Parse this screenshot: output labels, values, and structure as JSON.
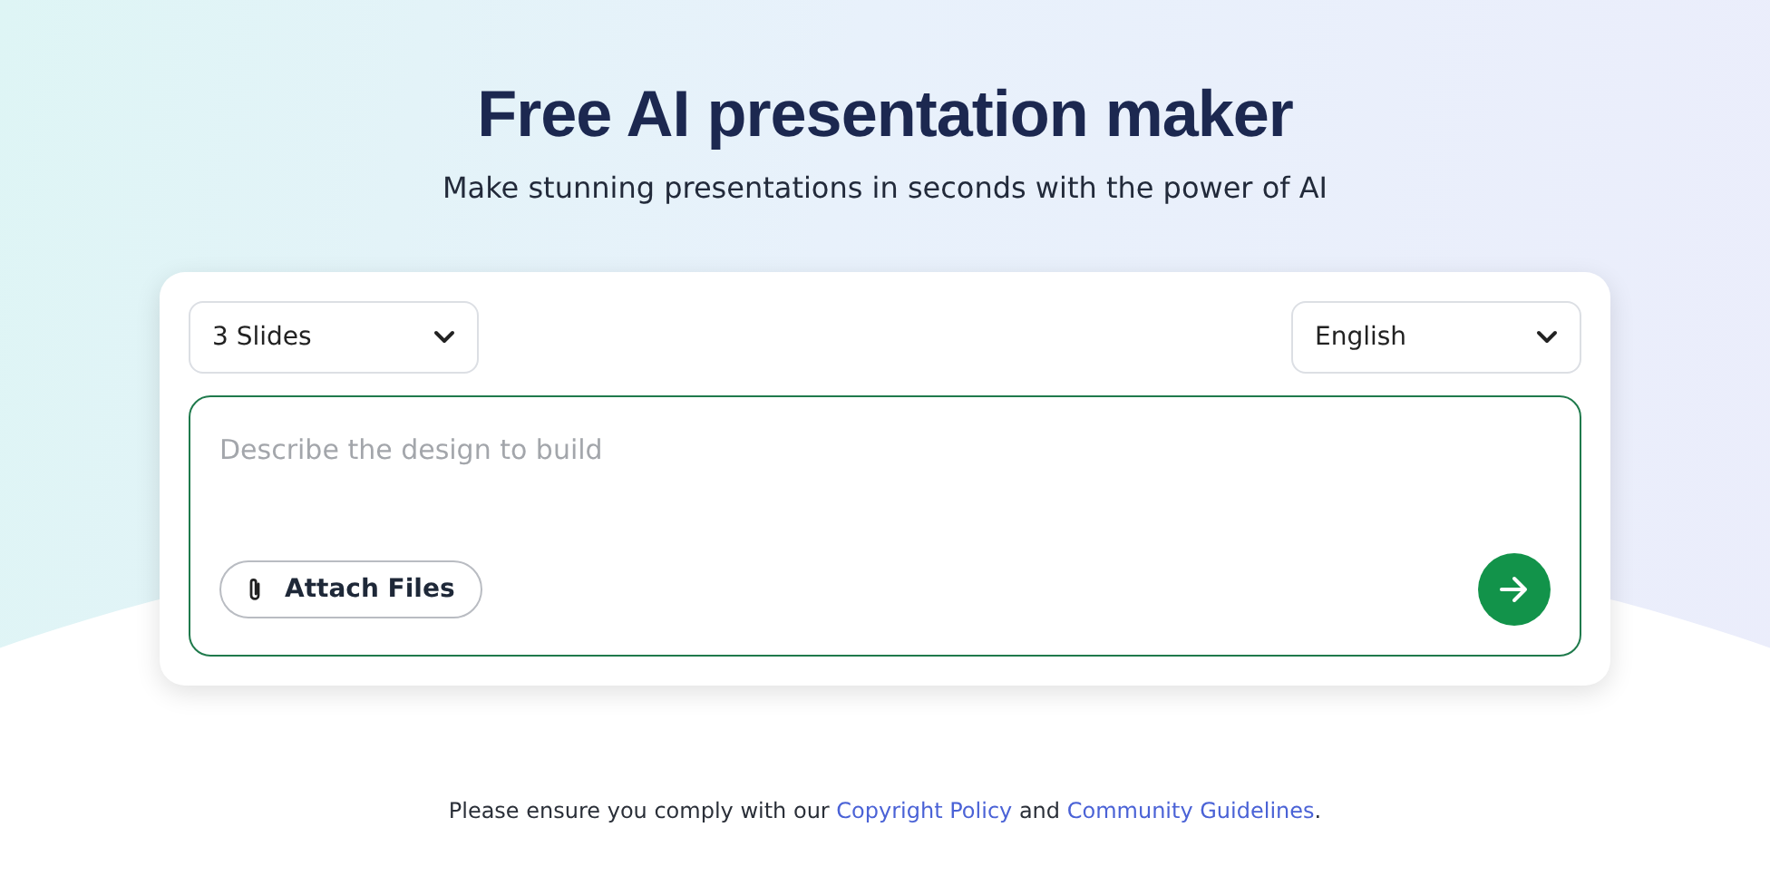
{
  "title": "Free AI presentation maker",
  "subtitle": "Make stunning presentations in seconds with the power of AI",
  "selects": [
    {
      "value": "3 Slides"
    },
    {
      "value": "English"
    }
  ],
  "prompt": {
    "placeholder": "Describe the design to build"
  },
  "attach_button": "Attach Files",
  "notice": [
    {
      "kind": "text",
      "text": "Please ensure you comply with our "
    },
    {
      "kind": "link",
      "text": "Copyright Policy"
    },
    {
      "kind": "text",
      "text": " and "
    },
    {
      "kind": "link",
      "text": "Community Guidelines"
    },
    {
      "kind": "text",
      "text": "."
    }
  ]
}
